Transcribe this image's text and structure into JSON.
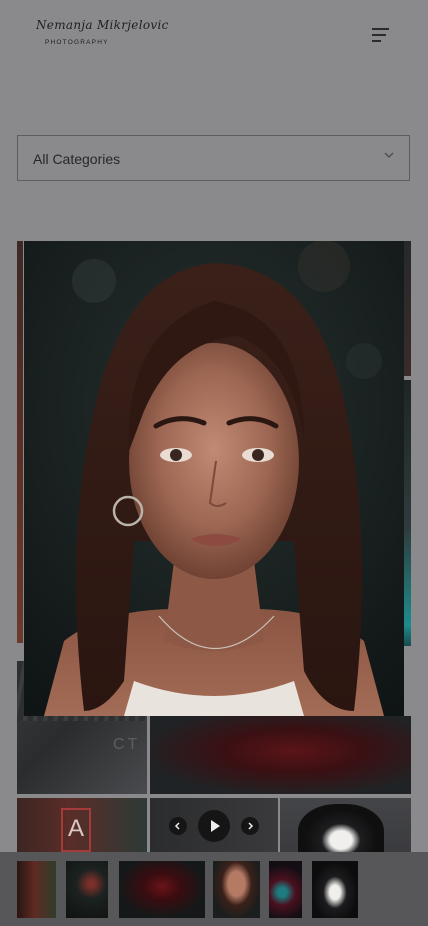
{
  "brand": {
    "script_name": "Nemanja Mikrjelovic",
    "subtitle": "PHOTOGRAPHY"
  },
  "filter": {
    "selected": "All Categories"
  },
  "icons": {
    "menu": "hamburger-menu-icon",
    "chevron": "chevron-down-icon",
    "prev": "chevron-left-icon",
    "play": "play-icon",
    "next": "chevron-right-icon"
  },
  "theme": {
    "page_overlay": "#8a8a8c",
    "filmstrip_bg": "#57575a",
    "control_bg": "#151515",
    "text_dark": "#27272a"
  },
  "gallery": {
    "tiles": [
      {
        "subject": "warm-left-strip"
      },
      {
        "subject": "dark-wall"
      },
      {
        "subject": "neon-right-strip"
      },
      {
        "subject": "street-sign"
      },
      {
        "subject": "red-rose"
      },
      {
        "subject": "neon-letter-a"
      },
      {
        "subject": "dog-portrait"
      }
    ]
  },
  "lightbox": {
    "subject": "portrait-woman"
  },
  "filmstrip": {
    "thumbnails": [
      {
        "subject": "neon-sign-warm"
      },
      {
        "subject": "night-street"
      },
      {
        "subject": "red-rose"
      },
      {
        "subject": "portrait-woman"
      },
      {
        "subject": "teal-flowers"
      },
      {
        "subject": "dog-portrait"
      }
    ]
  }
}
